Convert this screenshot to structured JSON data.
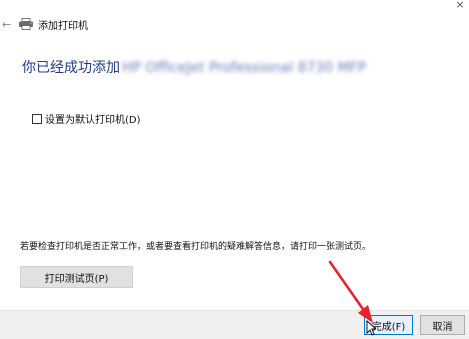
{
  "window": {
    "title": "添加打印机",
    "close_glyph": "×",
    "back_glyph": "←"
  },
  "main": {
    "heading_prefix": "你已经成功添加",
    "printer_name_obscured": " HP OfficeJet Professional 8730 MFP",
    "default_checkbox_label": "设置为默认打印机(D)",
    "default_checkbox_checked": false,
    "info_text": "若要检查打印机是否正常工作，或者要查看打印机的疑难解答信息，请打印一张测试页。",
    "test_page_button": "打印测试页(P)"
  },
  "footer": {
    "finish_button": "完成(F)",
    "cancel_button": "取消"
  },
  "colors": {
    "heading": "#1f3c88",
    "accent": "#0078d7",
    "annotation": "#e8202a"
  },
  "icons": {
    "close": "close-icon",
    "back": "back-arrow-icon",
    "printer": "printer-icon",
    "cursor": "mouse-cursor-icon"
  }
}
